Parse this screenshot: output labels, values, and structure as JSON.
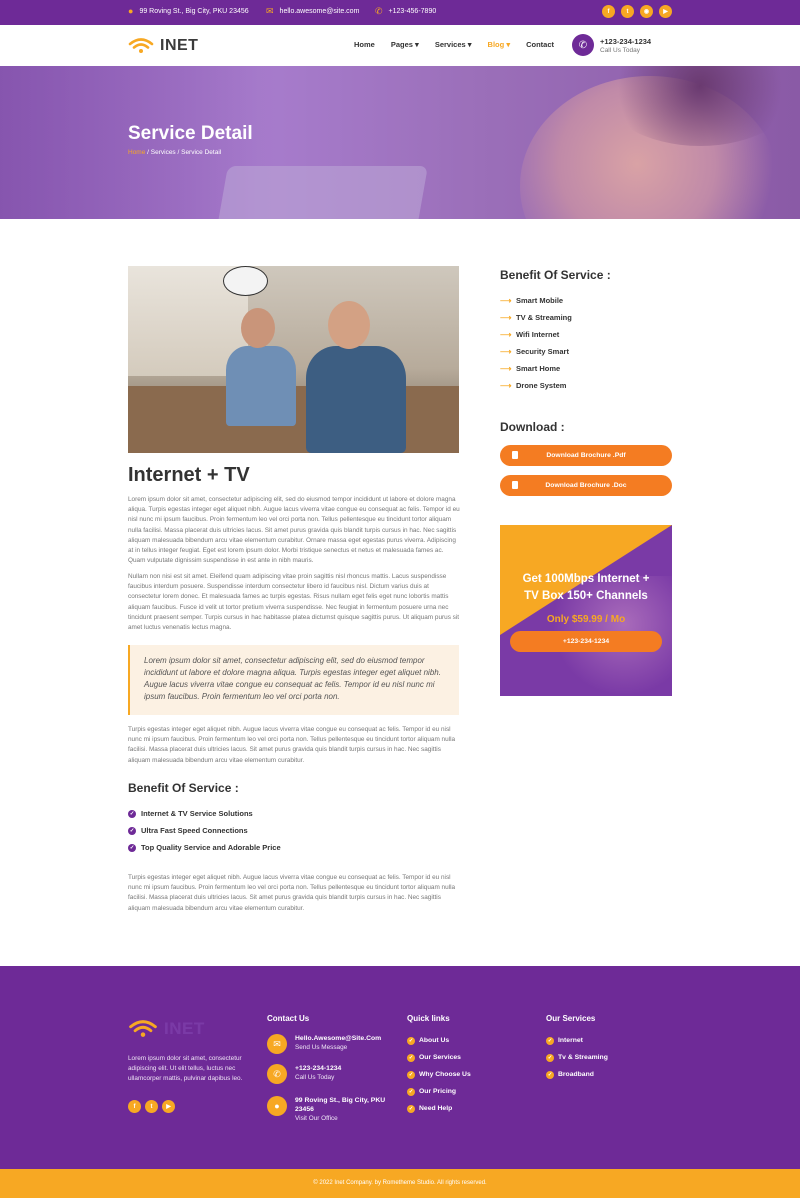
{
  "topbar": {
    "address": "99 Roving St., Big City, PKU 23456",
    "email": "hello.awesome@site.com",
    "phone": "+123-456-7890",
    "socials": [
      "facebook-icon",
      "twitter-icon",
      "instagram-icon",
      "youtube-icon"
    ]
  },
  "nav": {
    "logo": "INET",
    "menu": [
      "Home",
      "Pages",
      "Services",
      "Blog",
      "Contact"
    ],
    "active": "Blog",
    "call_number": "+123-234-1234",
    "call_sub": "Call Us Today"
  },
  "hero": {
    "title": "Service Detail",
    "crumb_home": "Home",
    "crumb_rest": " / Services / Service Detail"
  },
  "content": {
    "title": "Internet + TV",
    "para1": "Lorem ipsum dolor sit amet, consectetur adipiscing elit, sed do eiusmod tempor incididunt ut labore et dolore magna aliqua. Turpis egestas integer eget aliquet nibh. Augue lacus viverra vitae congue eu consequat ac felis. Tempor id eu nisl nunc mi ipsum faucibus. Proin fermentum leo vel orci porta non. Tellus pellentesque eu tincidunt tortor aliquam nulla facilisi. Massa placerat duis ultricies lacus. Sit amet purus gravida quis blandit turpis cursus in hac. Nec sagittis aliquam malesuada bibendum arcu vitae elementum curabitur. Ornare massa eget egestas purus viverra. Adipiscing at in tellus integer feugiat. Eget est lorem ipsum dolor. Morbi tristique senectus et netus et malesuada fames ac. Quam vulputate dignissim suspendisse in est ante in nibh mauris.",
    "para2": "Nullam non nisi est sit amet. Eleifend quam adipiscing vitae proin sagittis nisl rhoncus mattis. Lacus suspendisse faucibus interdum posuere. Suspendisse interdum consectetur libero id faucibus nisl. Dictum varius duis at consectetur lorem donec. Et malesuada fames ac turpis egestas. Risus nullam eget felis eget nunc lobortis mattis aliquam faucibus. Fusce id velit ut tortor pretium viverra suspendisse. Nec feugiat in fermentum posuere urna nec tincidunt praesent semper. Turpis cursus in hac habitasse platea dictumst quisque sagittis purus. Ut aliquam purus sit amet luctus venenatis lectus magna.",
    "quote": "Lorem ipsum dolor sit amet, consectetur adipiscing elit, sed do eiusmod tempor incididunt ut labore et dolore magna aliqua. Turpis egestas integer eget aliquet nibh. Augue lacus viverra vitae congue eu consequat ac felis. Tempor id eu nisl nunc mi ipsum faucibus. Proin fermentum leo vel orci porta non.",
    "para3": "Turpis egestas integer eget aliquet nibh. Augue lacus viverra vitae congue eu consequat ac felis. Tempor id eu nisl nunc mi ipsum faucibus. Proin fermentum leo vel orci porta non. Tellus pellentesque eu tincidunt tortor aliquam nulla facilisi. Massa placerat duis ultricies lacus. Sit amet purus gravida quis blandit turpis cursus in hac. Nec sagittis aliquam malesuada bibendum arcu vitae elementum curabitur.",
    "benefit_title": "Benefit Of Service :",
    "benefits": [
      "Internet & TV Service Solutions",
      "Ultra Fast Speed Connections",
      "Top Quality Service and Adorable Price"
    ],
    "para4": "Turpis egestas integer eget aliquet nibh. Augue lacus viverra vitae congue eu consequat ac felis. Tempor id eu nisl nunc mi ipsum faucibus. Proin fermentum leo vel orci porta non. Tellus pellentesque eu tincidunt tortor aliquam nulla facilisi. Massa placerat duis ultricies lacus. Sit amet purus gravida quis blandit turpis cursus in hac. Nec sagittis aliquam malesuada bibendum arcu vitae elementum curabitur."
  },
  "sidebar": {
    "benefit_title": "Benefit Of Service :",
    "services": [
      "Smart Mobile",
      "TV & Streaming",
      "Wifi Internet",
      "Security Smart",
      "Smart Home",
      "Drone System"
    ],
    "download_title": "Download :",
    "download_pdf": "Download Brochure .Pdf",
    "download_doc": "Download Brochure .Doc",
    "promo_line1": "Get 100Mbps Internet +",
    "promo_line2": "TV Box 150+ Channels",
    "promo_price": "Only $59.99 / Mo",
    "promo_phone": "+123-234-1234"
  },
  "footer": {
    "logo": "INET",
    "desc": "Lorem ipsum dolor sit amet, consectetur adipiscing elit. Ut elit tellus, luctus nec ullamcorper mattis, pulvinar dapibus leo.",
    "contact_title": "Contact Us",
    "contact": [
      {
        "line1": "Hello.Awesome@Site.Com",
        "line2": "Send Us Message"
      },
      {
        "line1": "+123-234-1234",
        "line2": "Call Us Today"
      },
      {
        "line1": "99 Roving St., Big City, PKU 23456",
        "line2": "Visit Our Office"
      }
    ],
    "quick_title": "Quick links",
    "quick": [
      "About Us",
      "Our Services",
      "Why Choose Us",
      "Our Pricing",
      "Need Help"
    ],
    "services_title": "Our Services",
    "services": [
      "Internet",
      "Tv & Streaming",
      "Broadband"
    ],
    "copyright": "© 2022 Inet Company. by Rometheme Studio. All rights reserved."
  },
  "colors": {
    "primary": "#6e2a97",
    "accent": "#f7a823",
    "button": "#f47c22"
  }
}
